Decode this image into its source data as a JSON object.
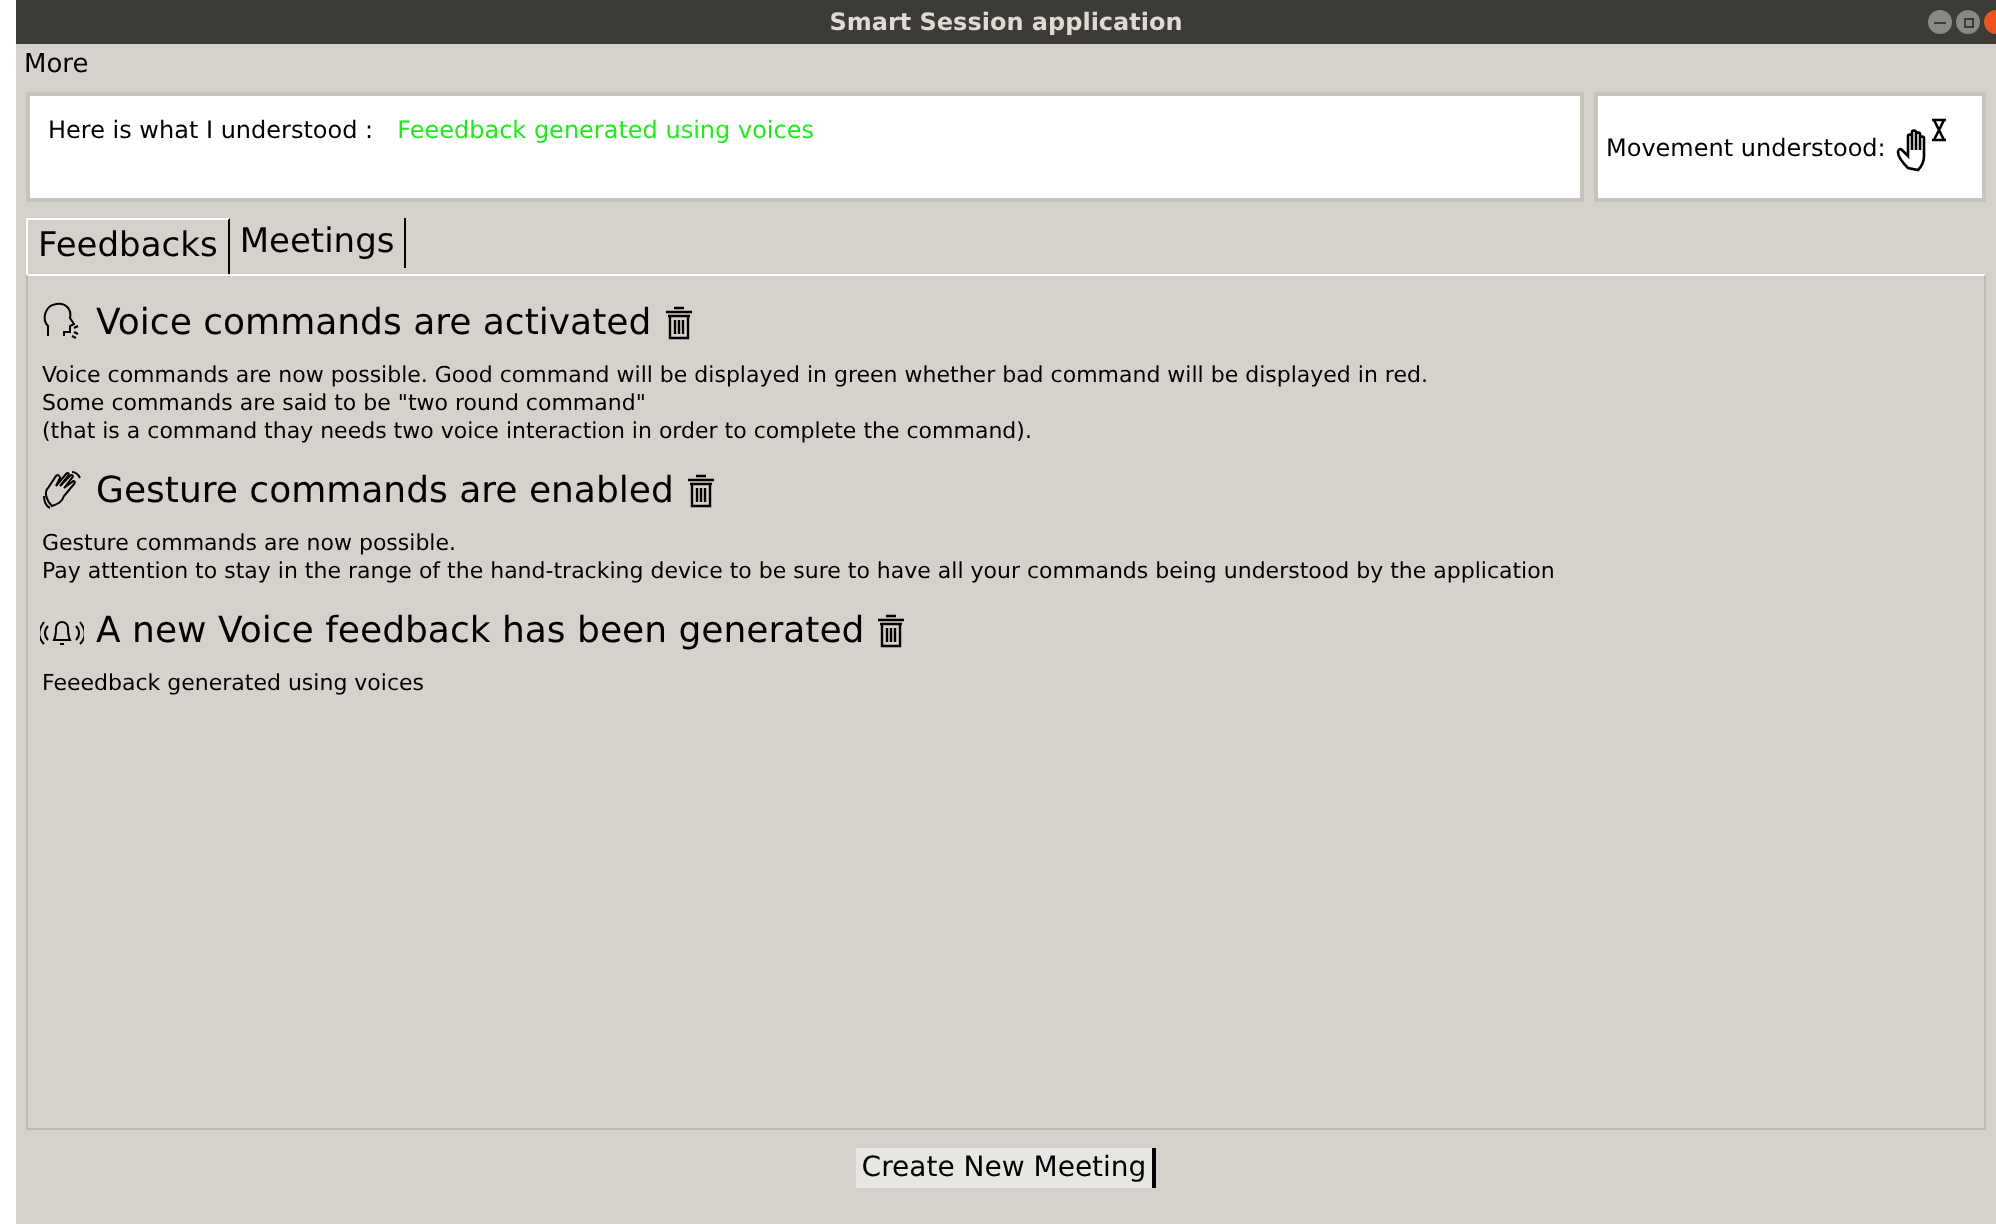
{
  "window": {
    "title": "Smart Session application"
  },
  "menu": [
    "More"
  ],
  "understood": {
    "label": "Here is what I understood :",
    "value": "Feeedback generated using voices"
  },
  "movement": {
    "label": "Movement understood:"
  },
  "tabs": [
    {
      "label": "Feedbacks",
      "selected": true
    },
    {
      "label": "Meetings",
      "selected": false
    }
  ],
  "feedbacks": [
    {
      "kind": "voice",
      "title": "Voice commands are activated",
      "text": "Voice commands are now possible. Good command will be displayed in green whether bad command will be displayed in red.\nSome commands are said to be \"two round command\"\n(that is a command thay needs two voice interaction in order to complete the command)."
    },
    {
      "kind": "gesture",
      "title": "Gesture commands are enabled",
      "text": "Gesture commands are now possible.\nPay attention to stay in the range of the hand-tracking device to be sure to have all your commands being understood by the application"
    },
    {
      "kind": "notification",
      "title": "A new Voice feedback has been generated",
      "text": "Feeedback generated using voices"
    }
  ],
  "button": "Create New Meeting"
}
